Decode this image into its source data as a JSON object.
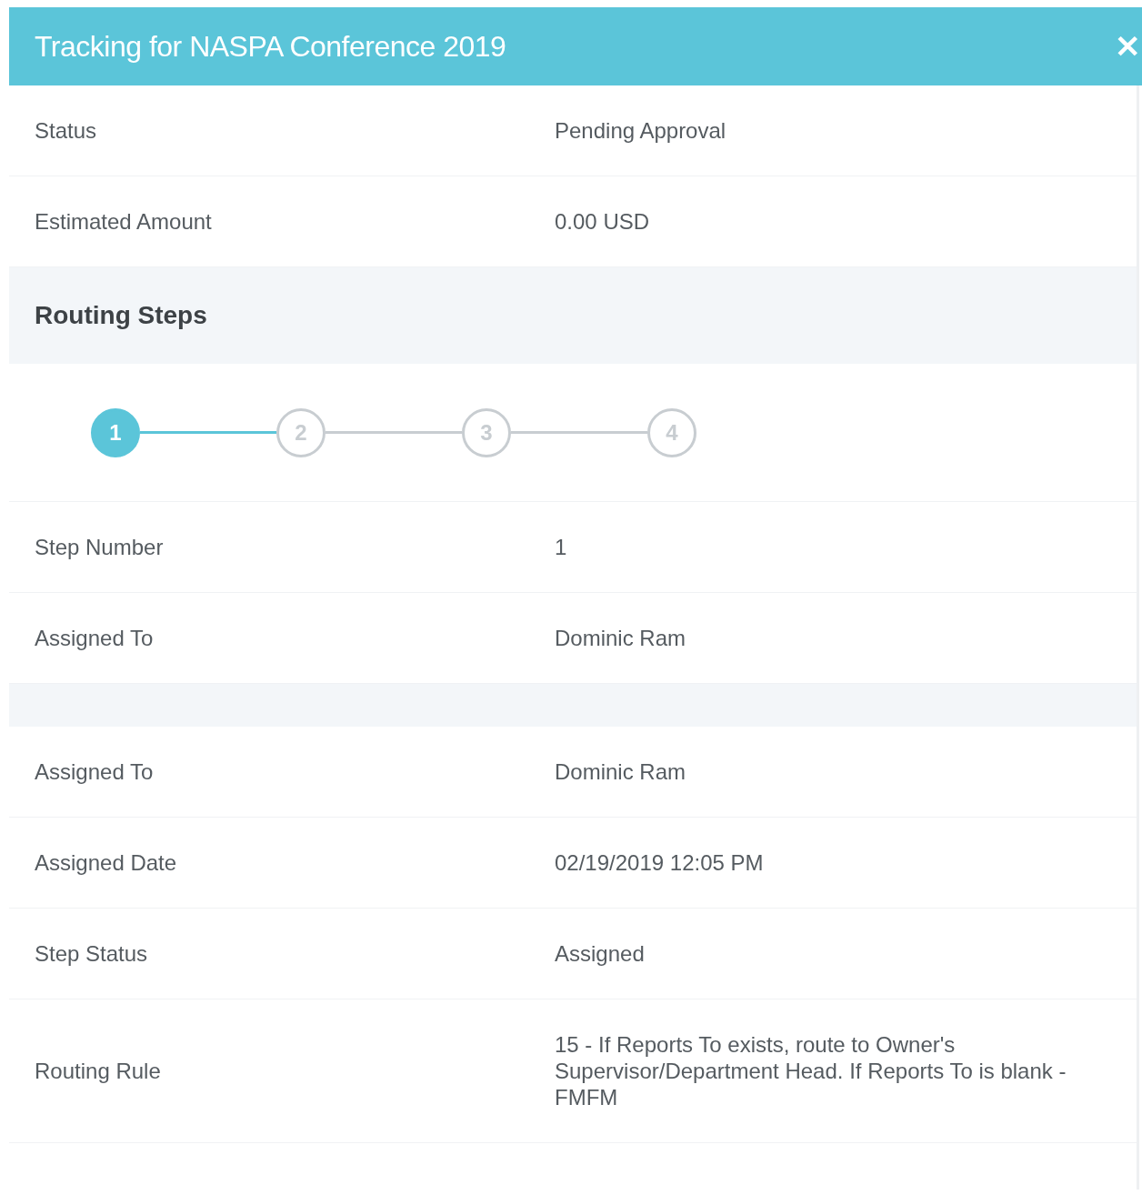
{
  "dialog": {
    "title": "Tracking for NASPA Conference 2019",
    "close": "✕"
  },
  "summary": [
    {
      "label": "Status",
      "value": "Pending Approval"
    },
    {
      "label": "Estimated Amount",
      "value": "0.00 USD"
    }
  ],
  "routing_steps": {
    "heading": "Routing Steps",
    "steps": [
      {
        "number": "1",
        "selected": true
      },
      {
        "number": "2",
        "selected": false
      },
      {
        "number": "3",
        "selected": false
      },
      {
        "number": "4",
        "selected": false
      }
    ],
    "step_info": [
      {
        "label": "Step Number",
        "value": "1"
      },
      {
        "label": "Assigned To",
        "value": "Dominic Ram"
      }
    ],
    "assignment": [
      {
        "label": "Assigned To",
        "value": "Dominic Ram"
      },
      {
        "label": "Assigned Date",
        "value": "02/19/2019 12:05 PM"
      },
      {
        "label": "Step Status",
        "value": "Assigned"
      },
      {
        "label": "Routing Rule",
        "value": "15 - If Reports To exists, route to Owner's Supervisor/Department Head. If Reports To is blank - FMFM"
      }
    ]
  }
}
